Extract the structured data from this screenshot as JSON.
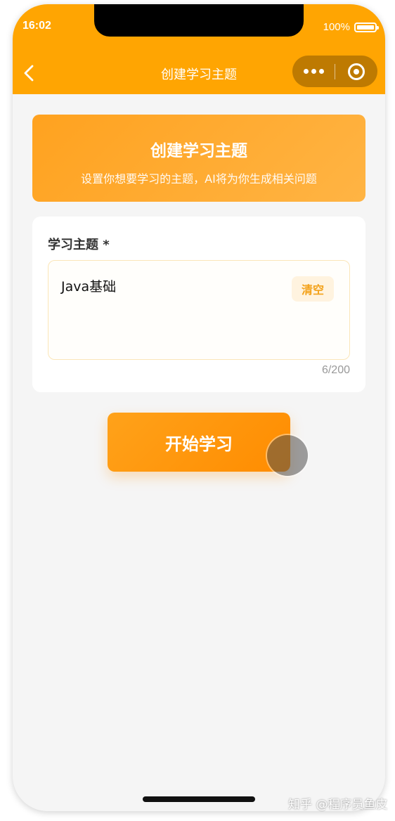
{
  "status_bar": {
    "time": "16:02",
    "battery": "100%"
  },
  "nav": {
    "title": "创建学习主题"
  },
  "banner": {
    "title": "创建学习主题",
    "subtitle": "设置你想要学习的主题，AI将为你生成相关问题"
  },
  "form": {
    "label": "学习主题 *",
    "value": "Java基础",
    "clear_label": "清空",
    "counter": "6/200"
  },
  "actions": {
    "start_label": "开始学习"
  },
  "watermark": "知乎 @程序员鱼皮",
  "colors": {
    "accent": "#ffa502",
    "background": "#f5f5f5"
  }
}
